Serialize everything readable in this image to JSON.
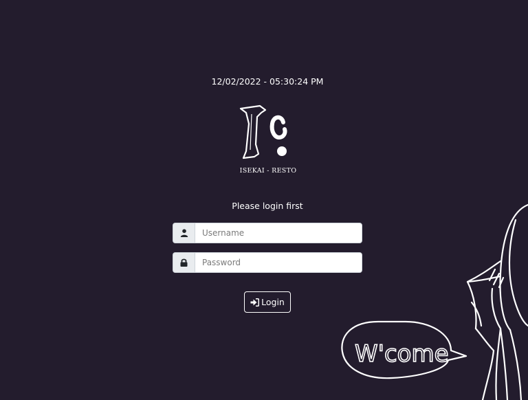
{
  "header": {
    "datetime": "12/02/2022 - 05:30:24 PM"
  },
  "brand": {
    "logo_icon": "isekai-resto-logo",
    "name": "ISEKAI - RESTO"
  },
  "login": {
    "prompt": "Please login first",
    "username": {
      "icon": "user-icon",
      "placeholder": "Username",
      "value": ""
    },
    "password": {
      "icon": "lock-icon",
      "placeholder": "Password",
      "value": ""
    },
    "submit_icon": "sign-in-icon",
    "submit_label": "Login"
  },
  "decoration": {
    "speech_text": "W'come"
  },
  "colors": {
    "background": "#231c2d",
    "text": "#ffffff",
    "input_addon": "#e9ecef"
  }
}
